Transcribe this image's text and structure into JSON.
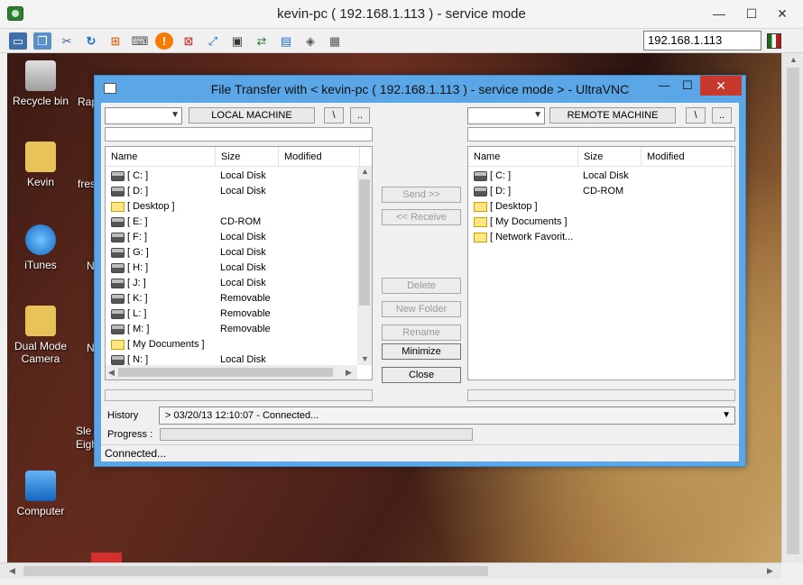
{
  "viewer": {
    "title": "kevin-pc ( 192.168.1.113 ) - service mode",
    "minimize": "—",
    "maximize": "☐",
    "close": "✕",
    "ip_value": "192.168.1.113"
  },
  "toolbar_icons": [
    "monitor-icon",
    "windows-icon",
    "tools-icon",
    "refresh-icon",
    "windows-logo-icon",
    "keyboard-icon",
    "stop-icon",
    "disconnect-icon",
    "fullscreen-icon",
    "screen-icon",
    "transfer-icon",
    "window-icon",
    "chat-icon",
    "options-icon"
  ],
  "desktop": {
    "icons": [
      {
        "label": "Recycle bin"
      },
      {
        "label": "Kevin"
      },
      {
        "label": "iTunes"
      },
      {
        "label": "Dual Mode Camera"
      },
      {
        "label": "Computer"
      }
    ],
    "partial_labels": [
      "Rap",
      "fres",
      "N",
      "N",
      "Sle",
      "Eigh"
    ]
  },
  "dialog": {
    "title": "File Transfer with < kevin-pc ( 192.168.1.113 ) - service mode >  -  UltraVNC",
    "minimize": "—",
    "maximize": "☐",
    "close": "✕",
    "local_label": "LOCAL MACHINE",
    "remote_label": "REMOTE MACHINE",
    "root_btn": "\\",
    "up_btn": "..",
    "columns": {
      "name": "Name",
      "size": "Size",
      "modified": "Modified"
    },
    "local_items": [
      {
        "name": "[ C: ]",
        "size": "Local Disk",
        "type": "drive"
      },
      {
        "name": "[ D: ]",
        "size": "Local Disk",
        "type": "drive"
      },
      {
        "name": "[ Desktop ]",
        "size": "",
        "type": "folder"
      },
      {
        "name": "[ E: ]",
        "size": "CD-ROM",
        "type": "drive"
      },
      {
        "name": "[ F: ]",
        "size": "Local Disk",
        "type": "drive"
      },
      {
        "name": "[ G: ]",
        "size": "Local Disk",
        "type": "drive"
      },
      {
        "name": "[ H: ]",
        "size": "Local Disk",
        "type": "drive"
      },
      {
        "name": "[ J: ]",
        "size": "Local Disk",
        "type": "drive"
      },
      {
        "name": "[ K: ]",
        "size": "Removable",
        "type": "drive"
      },
      {
        "name": "[ L: ]",
        "size": "Removable",
        "type": "drive"
      },
      {
        "name": "[ M: ]",
        "size": "Removable",
        "type": "drive"
      },
      {
        "name": "[ My Documents ]",
        "size": "",
        "type": "folder"
      },
      {
        "name": "[ N: ]",
        "size": "Local Disk",
        "type": "drive"
      }
    ],
    "remote_items": [
      {
        "name": "[ C: ]",
        "size": "Local Disk",
        "type": "drive"
      },
      {
        "name": "[ D: ]",
        "size": "CD-ROM",
        "type": "drive"
      },
      {
        "name": "[ Desktop ]",
        "size": "",
        "type": "folder"
      },
      {
        "name": "[ My Documents ]",
        "size": "",
        "type": "folder"
      },
      {
        "name": "[ Network Favorit...",
        "size": "",
        "type": "folder"
      }
    ],
    "actions": {
      "send": "Send >>",
      "receive": "<< Receive",
      "delete": "Delete",
      "new_folder": "New Folder",
      "rename": "Rename",
      "minimize": "Minimize",
      "close": "Close"
    },
    "history_label": "History",
    "history_value": "> 03/20/13 12:10:07 -  Connected...",
    "progress_label": "Progress :",
    "progress": 0,
    "status": "Connected..."
  }
}
